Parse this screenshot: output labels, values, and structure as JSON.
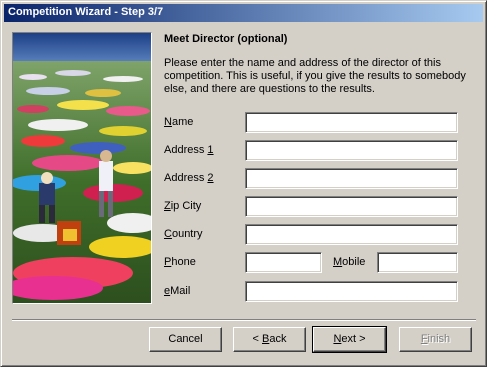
{
  "window": {
    "title": "Competition Wizard - Step 3/7"
  },
  "page": {
    "heading": "Meet Director (optional)",
    "description": "Please enter the name and address of the director of this competition. This is useful, if you give the results to somebody else, and there are questions to the results."
  },
  "form": {
    "name": {
      "pre": "",
      "key": "N",
      "post": "ame",
      "value": ""
    },
    "address1": {
      "pre": "Address ",
      "key": "1",
      "post": "",
      "value": ""
    },
    "address2": {
      "pre": "Address ",
      "key": "2",
      "post": "",
      "value": ""
    },
    "zipcity": {
      "pre": "",
      "key": "Z",
      "post": "ip City",
      "value": ""
    },
    "country": {
      "pre": "",
      "key": "C",
      "post": "ountry",
      "value": ""
    },
    "phone": {
      "pre": "",
      "key": "P",
      "post": "hone",
      "value": ""
    },
    "mobile": {
      "pre": "",
      "key": "M",
      "post": "obile",
      "value": ""
    },
    "email": {
      "pre": "",
      "key": "e",
      "post": "Mail",
      "value": ""
    }
  },
  "buttons": {
    "cancel": {
      "pre": "Cancel",
      "key": "",
      "post": ""
    },
    "back": {
      "pre": "< ",
      "key": "B",
      "post": "ack"
    },
    "next": {
      "pre": "",
      "key": "N",
      "post": "ext >"
    },
    "finish": {
      "pre": "",
      "key": "F",
      "post": "inish"
    }
  },
  "colors": {
    "dialog_face": "#d4d0c8",
    "title_start": "#0a246a",
    "title_end": "#a6caf0"
  }
}
